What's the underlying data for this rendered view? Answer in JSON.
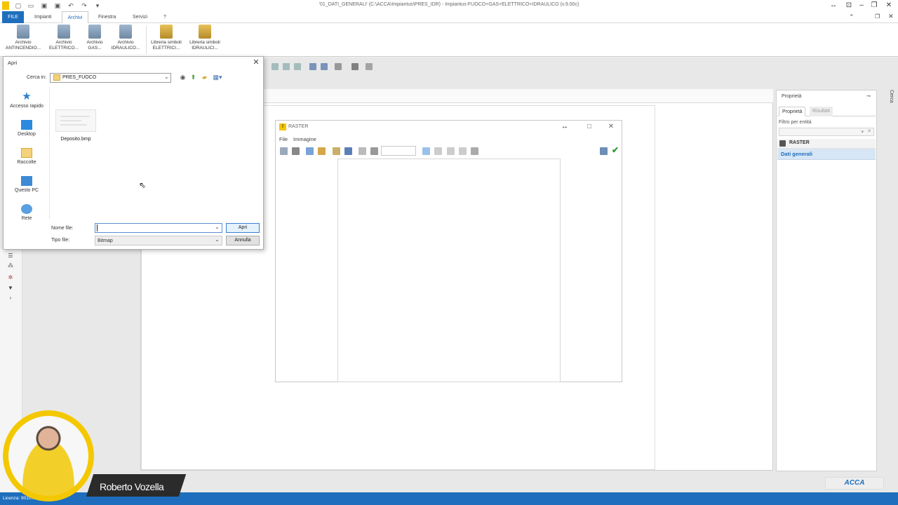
{
  "app": {
    "title": "'01_DATI_GENERALI' (C:\\ACCA\\Impiantus\\PRES_IDR) - Impiantus-FUOCO+GAS+ELETTRICO+IDRAULICO (v.9.00c)"
  },
  "menu": {
    "tabs": [
      "FILE",
      "Impianti",
      "Archivi",
      "Finestra",
      "Servizi",
      "?"
    ]
  },
  "ribbon": {
    "buttons": [
      {
        "line1": "Archivio",
        "line2": "ANTINCENDIO..."
      },
      {
        "line1": "Archivio",
        "line2": "ELETTRICO..."
      },
      {
        "line1": "Archivio",
        "line2": "GAS..."
      },
      {
        "line1": "Archivio",
        "line2": "IDRAULICO..."
      },
      {
        "line1": "Libreria simboli",
        "line2": "ELETTRICI..."
      },
      {
        "line1": "Libreria simboli",
        "line2": "IDRAULICI..."
      }
    ]
  },
  "dialog": {
    "title": "Apri",
    "look_in_label": "Cerca in:",
    "look_in_value": "PRES_FUOCO",
    "places": [
      "Accesso rapido",
      "Desktop",
      "Raccolte",
      "Questo PC",
      "Rete"
    ],
    "files": [
      {
        "name": "Deposito.bmp"
      }
    ],
    "filename_label": "Nome file:",
    "filename_value": "",
    "filetype_label": "Tipo file:",
    "filetype_value": "Bitmap",
    "open_button": "Apri",
    "cancel_button": "Annulla"
  },
  "raster": {
    "title": "RASTER",
    "menu": [
      "File",
      "Immagine"
    ]
  },
  "properties": {
    "title": "Proprietà",
    "tabs": [
      "Proprietà",
      "Risultati"
    ],
    "filter_label": "Filtro per entità",
    "section": "RASTER",
    "selected_row": "Dati generali",
    "side_search": "Cerca"
  },
  "presenter": {
    "name": "Roberto Vozella"
  },
  "status": {
    "license": "Licenza: 9010..."
  },
  "brand": {
    "logo": "ACCA",
    "accent": "#1f6ebd"
  }
}
